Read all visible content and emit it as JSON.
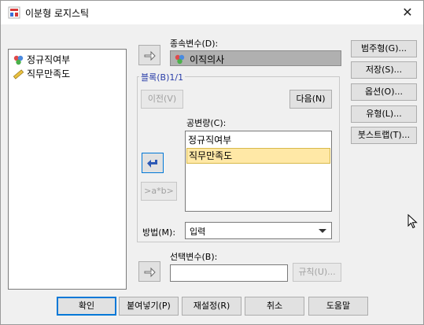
{
  "window": {
    "title": "이분형 로지스틱"
  },
  "source_list": {
    "items": [
      {
        "label": "정규직여부",
        "icon": "nominal-variable-icon"
      },
      {
        "label": "직무만족도",
        "icon": "scale-variable-icon"
      }
    ]
  },
  "dependent": {
    "label": "종속변수(D):",
    "value": "이직의사"
  },
  "block": {
    "title": "블록(B)1/1",
    "prev_label": "이전(V)",
    "next_label": "다음(N)"
  },
  "covariates": {
    "label": "공변량(C):",
    "items": [
      "정규직여부",
      "직무만족도"
    ],
    "selected_index": 1
  },
  "interaction_label": ">a*b>",
  "method": {
    "label": "방법(M):",
    "value": "입력"
  },
  "selection": {
    "label": "선택변수(B):",
    "value": "",
    "rule_label": "규칙(U)..."
  },
  "side_buttons": [
    "범주형(G)...",
    "저장(S)...",
    "옵션(O)...",
    "유형(L)...",
    "붓스트랩(T)..."
  ],
  "bottom_buttons": [
    "확인",
    "붙여넣기(P)",
    "재설정(R)",
    "취소",
    "도움말"
  ],
  "colors": {
    "accent": "#0078d7",
    "arrow": "#2c59b5",
    "selection": "#ffe8a6"
  }
}
